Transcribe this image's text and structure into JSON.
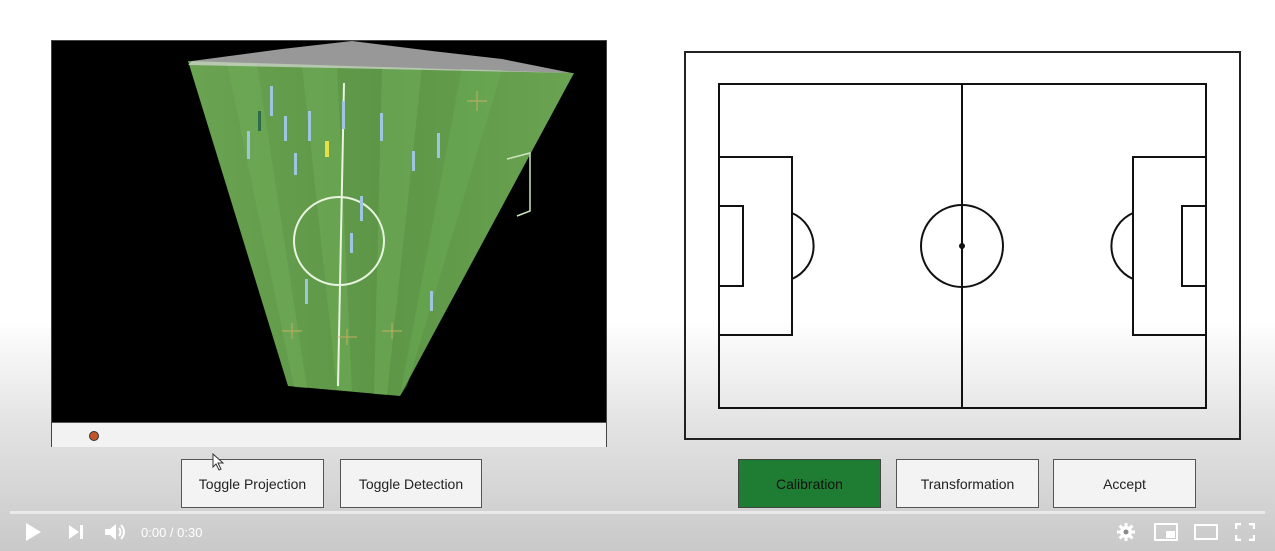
{
  "left_buttons": {
    "toggle_projection": "Toggle Projection",
    "toggle_detection": "Toggle Detection"
  },
  "right_buttons": {
    "calibration": "Calibration",
    "transformation": "Transformation",
    "accept": "Accept"
  },
  "player": {
    "time": "0:00 / 0:30",
    "progress": 0
  },
  "icons": {
    "play": "play-icon",
    "next": "next-icon",
    "volume": "volume-icon",
    "settings": "gear-icon",
    "miniplayer": "miniplayer-icon",
    "theater": "theater-icon",
    "fullscreen": "fullscreen-icon"
  },
  "colors": {
    "active_button": "#1e7d32",
    "pitch_green": "#5f9a4a",
    "marker": "#c0552a"
  }
}
